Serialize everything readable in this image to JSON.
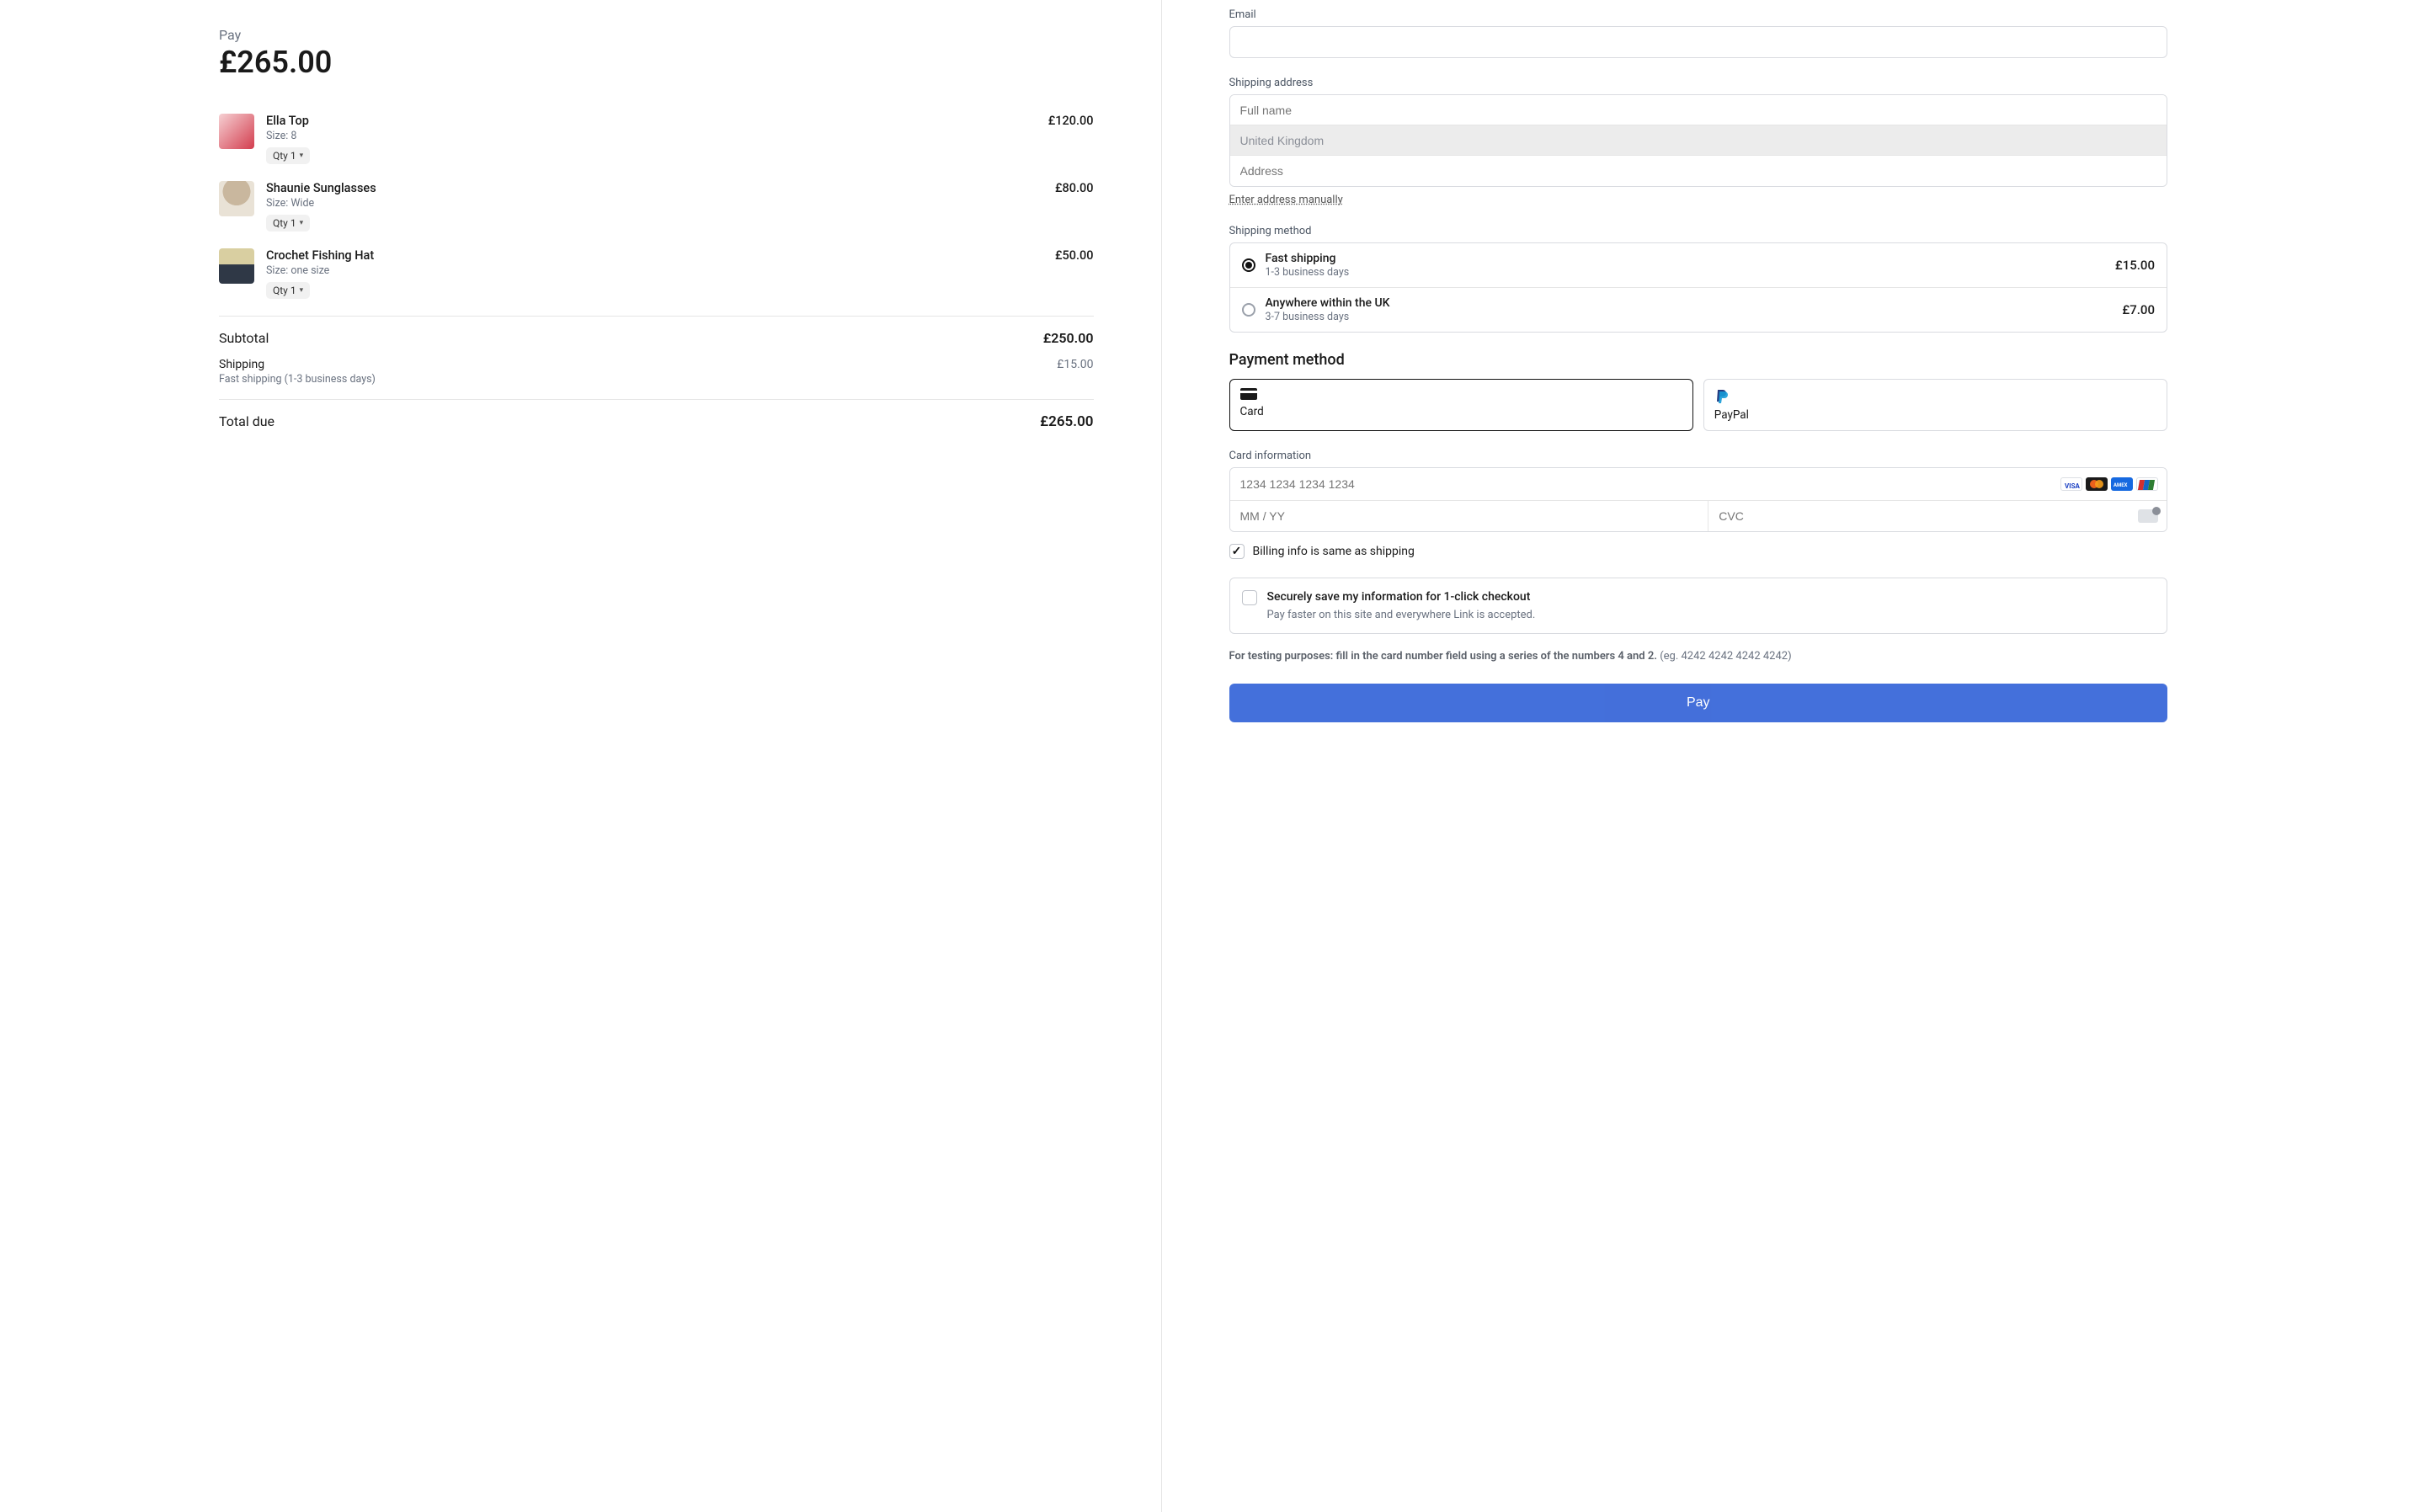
{
  "summary": {
    "pay_label": "Pay",
    "pay_amount": "£265.00",
    "items": [
      {
        "name": "Ella Top",
        "size": "Size: 8",
        "qty": "Qty 1",
        "price": "£120.00"
      },
      {
        "name": "Shaunie Sunglasses",
        "size": "Size: Wide",
        "qty": "Qty 1",
        "price": "£80.00"
      },
      {
        "name": "Crochet Fishing Hat",
        "size": "Size: one size",
        "qty": "Qty 1",
        "price": "£50.00"
      }
    ],
    "subtotal_label": "Subtotal",
    "subtotal_value": "£250.00",
    "shipping_label": "Shipping",
    "shipping_value": "£15.00",
    "shipping_note": "Fast shipping (1-3 business days)",
    "total_label": "Total due",
    "total_value": "£265.00"
  },
  "form": {
    "email_label": "Email",
    "shipping_address_label": "Shipping address",
    "fullname_placeholder": "Full name",
    "country_value": "United Kingdom",
    "address_placeholder": "Address",
    "manual_link": "Enter address manually",
    "shipping_method_label": "Shipping method",
    "shipping_options": [
      {
        "title": "Fast shipping",
        "sub": "1-3 business days",
        "price": "£15.00",
        "checked": true
      },
      {
        "title": "Anywhere within the UK",
        "sub": "3-7 business days",
        "price": "£7.00",
        "checked": false
      }
    ],
    "payment_method_label": "Payment method",
    "payopt_card": "Card",
    "payopt_paypal": "PayPal",
    "card_info_label": "Card information",
    "card_number_placeholder": "1234 1234 1234 1234",
    "card_exp_placeholder": "MM / YY",
    "card_cvc_placeholder": "CVC",
    "billing_same_label": "Billing info is same as shipping",
    "save_title": "Securely save my information for 1-click checkout",
    "save_sub": "Pay faster on this site and everywhere Link is accepted.",
    "test_note_bold": "For testing purposes: fill in the card number field using a series of the numbers 4 and 2.",
    "test_note_rest": " (eg. 4242 4242 4242 4242)",
    "pay_button": "Pay"
  }
}
